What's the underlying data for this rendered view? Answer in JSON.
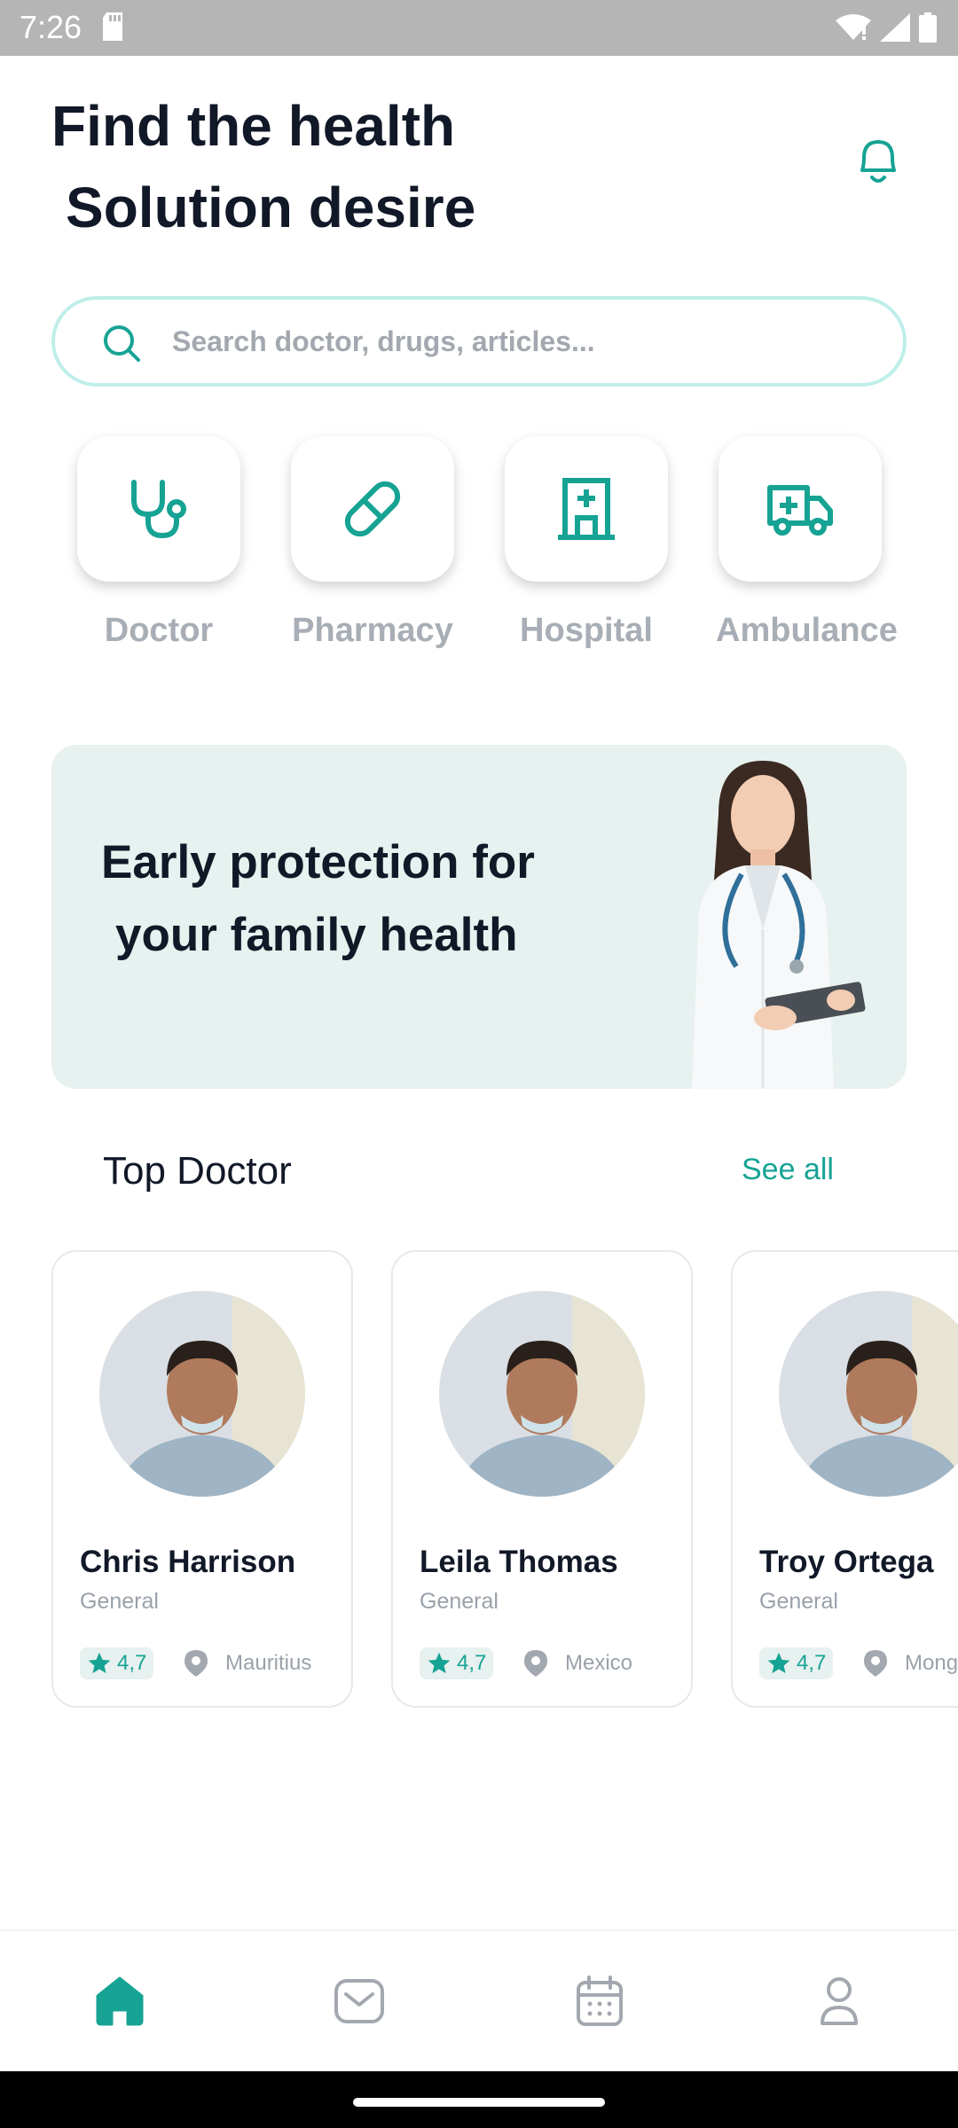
{
  "status_bar": {
    "time": "7:26"
  },
  "header": {
    "headline_line1": "Find the health",
    "headline_line2": "Solution desire"
  },
  "search": {
    "placeholder": "Search doctor, drugs, articles..."
  },
  "categories": [
    {
      "label": "Doctor",
      "icon": "stethoscope-icon"
    },
    {
      "label": "Pharmacy",
      "icon": "pill-icon"
    },
    {
      "label": "Hospital",
      "icon": "hospital-icon"
    },
    {
      "label": "Ambulance",
      "icon": "ambulance-icon"
    }
  ],
  "banner": {
    "line1": "Early protection for",
    "line2": "your family health"
  },
  "top_doctor": {
    "title": "Top Doctor",
    "see_all": "See all",
    "doctors": [
      {
        "name": "Chris Harrison",
        "specialty": "General",
        "rating": "4,7",
        "location": "Mauritius"
      },
      {
        "name": "Leila Thomas",
        "specialty": "General",
        "rating": "4,7",
        "location": "Mexico"
      },
      {
        "name": "Troy Ortega",
        "specialty": "General",
        "rating": "4,7",
        "location": "Mongolia"
      }
    ]
  },
  "bottom_nav": [
    {
      "icon": "home-icon",
      "active": true
    },
    {
      "icon": "message-icon",
      "active": false
    },
    {
      "icon": "calendar-icon",
      "active": false
    },
    {
      "icon": "profile-icon",
      "active": false
    }
  ],
  "colors": {
    "accent": "#16a394",
    "accent_light": "#bfeeea",
    "banner_bg": "#e7f1ef"
  }
}
